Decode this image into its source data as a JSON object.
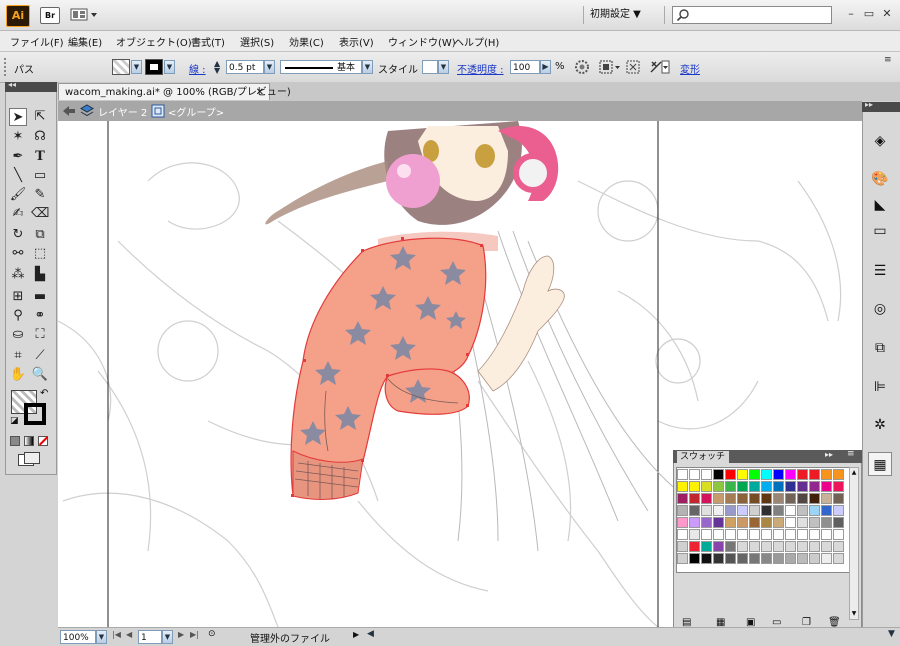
{
  "title_bar": {
    "app_icon": "Ai",
    "bridge_button": "Br",
    "layout_icon": "layout-grid-icon",
    "workspace": "初期設定 ▼",
    "search_placeholder": "",
    "minimize": "–",
    "restore": "▭",
    "close": "✕"
  },
  "menu": [
    "ファイル(F)",
    "編集(E)",
    "オブジェクト(O)",
    "書式(T)",
    "選択(S)",
    "効果(C)",
    "表示(V)",
    "ウィンドウ(W)",
    "ヘルプ(H)"
  ],
  "control_bar": {
    "selection_type": "パス",
    "stroke_label": "線 :",
    "stroke_weight": "0.5 pt",
    "brush_name": "基本",
    "style_label": "スタイル :",
    "opacity_label": "不透明度 :",
    "opacity_value": "100",
    "percent": "%",
    "transform_link": "変形"
  },
  "document": {
    "tab_label": "wacom_making.ai* @ 100% (RGB/プレビュー)",
    "tab_close": "✕",
    "layer_label": "レイヤー 2",
    "group_label": "<グループ>"
  },
  "colors": {
    "selection": "#e43a3a",
    "sweater": "#f5a18a",
    "stars": "#8a8aa0",
    "canvas": "#ffffff",
    "pasteboard": "#ffffff",
    "headphones": "#ea5f8f"
  },
  "swatches": {
    "tab_label": "スウォッチ",
    "rows": [
      [
        "#ffffff",
        "#ffffff",
        "#ffffff",
        "#000000",
        "#ff0000",
        "#ffff00",
        "#00ff00",
        "#00ffff",
        "#0000ff",
        "#ff00ff",
        "#ed1c24",
        "#ed1c24",
        "#f7941d",
        "#f7941d"
      ],
      [
        "#fff200",
        "#fff200",
        "#d7df23",
        "#8dc63f",
        "#39b54a",
        "#00a651",
        "#00a99d",
        "#00aeef",
        "#0072bc",
        "#2e3192",
        "#662d91",
        "#92278f",
        "#ec008c",
        "#ed145b"
      ],
      [
        "#9e1f63",
        "#c1272d",
        "#d4145a",
        "#c69c6d",
        "#a67c52",
        "#8c6239",
        "#754c24",
        "#603813",
        "#998675",
        "#736357",
        "#534741",
        "#42210b",
        "#c7b299",
        "#736357"
      ],
      [
        "#b3b3b3",
        "#666666",
        "#e0e0e0",
        "#f0f0f0",
        "#9999cc",
        "#ccccff",
        "#d0d0d0",
        "#303030",
        "#808080",
        "#ffffff",
        "#c0c0c0",
        "#9bd4f5",
        "#3366cc",
        "#ccccff"
      ],
      [
        "#ff99cc",
        "#cc99ff",
        "#9966cc",
        "#663399",
        "#d0a060",
        "#cc9966",
        "#996633",
        "#aa8844",
        "#ccaa77",
        "#ffffff",
        "#e0e0e0",
        "#c0c0c0",
        "#909090",
        "#606060"
      ],
      [
        "#ffffff",
        "#e8e8e8",
        "#ffffff",
        "#ffffff",
        "#ffffff",
        "#ffffff",
        "#ffffff",
        "#ffffff",
        "#ffffff",
        "#ffffff",
        "#ffffff",
        "#ffffff",
        "#ffffff",
        "#ffffff"
      ],
      [
        "#d0d0d0",
        "#ee2233",
        "#00aa99",
        "#8844aa",
        "#777777",
        "#d9d9d9",
        "#d9d9d9",
        "#d9d9d9",
        "#d9d9d9",
        "#d9d9d9",
        "#d9d9d9",
        "#d9d9d9",
        "#d9d9d9",
        "#d9d9d9"
      ],
      [
        "#d0d0d0",
        "#000000",
        "#111111",
        "#333333",
        "#555555",
        "#666666",
        "#777777",
        "#888888",
        "#999999",
        "#aaaaaa",
        "#bbbbbb",
        "#cccccc",
        "#eeeeee",
        "#d9d9d9"
      ]
    ]
  },
  "status_bar": {
    "zoom": "100%",
    "page": "1",
    "status_text": "管理外のファイル"
  }
}
